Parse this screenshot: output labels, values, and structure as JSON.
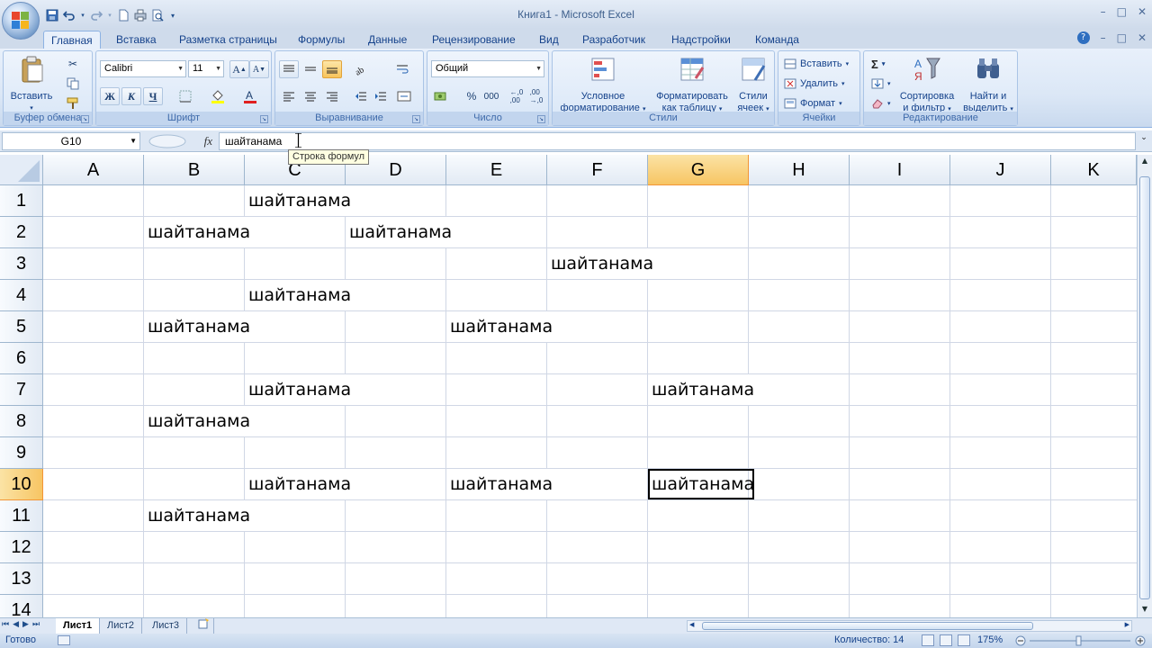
{
  "window": {
    "title": "Книга1 - Microsoft Excel",
    "controls": [
      "–",
      "□",
      "✕"
    ]
  },
  "qat": {
    "icons": [
      "save-icon",
      "undo-icon",
      "redo-icon",
      "new-icon",
      "print-icon",
      "print-preview-icon"
    ]
  },
  "tabs": [
    {
      "label": "Главная",
      "active": true
    },
    {
      "label": "Вставка"
    },
    {
      "label": "Разметка страницы"
    },
    {
      "label": "Формулы"
    },
    {
      "label": "Данные"
    },
    {
      "label": "Рецензирование"
    },
    {
      "label": "Вид"
    },
    {
      "label": "Разработчик"
    },
    {
      "label": "Надстройки"
    },
    {
      "label": "Команда"
    }
  ],
  "ribbon": {
    "clipboard": {
      "label": "Буфер обмена",
      "paste": "Вставить"
    },
    "font": {
      "label": "Шрифт",
      "name": "Calibri",
      "size": "11",
      "bold": "Ж",
      "italic": "К",
      "underline": "Ч"
    },
    "alignment": {
      "label": "Выравнивание"
    },
    "number": {
      "label": "Число",
      "format": "Общий",
      "percent": "%",
      "thousands": "000"
    },
    "styles": {
      "label": "Стили",
      "conditional": [
        "Условное",
        "форматирование"
      ],
      "as_table": [
        "Форматировать",
        "как таблицу"
      ],
      "cell_styles": [
        "Стили",
        "ячеек"
      ]
    },
    "cells": {
      "label": "Ячейки",
      "insert": "Вставить",
      "delete": "Удалить",
      "format": "Формат"
    },
    "editing": {
      "label": "Редактирование",
      "sum": "Σ",
      "sort": [
        "Сортировка",
        "и фильтр"
      ],
      "find": [
        "Найти и",
        "выделить"
      ]
    }
  },
  "formula_bar": {
    "name_box": "G10",
    "fx": "fx",
    "value": "шайтанама",
    "tooltip": "Строка формул"
  },
  "grid": {
    "columns": [
      "A",
      "B",
      "C",
      "D",
      "E",
      "F",
      "G",
      "H",
      "I",
      "J",
      "K"
    ],
    "rows": [
      "1",
      "2",
      "3",
      "4",
      "5",
      "6",
      "7",
      "8",
      "9",
      "10",
      "11",
      "12",
      "13",
      "14"
    ],
    "selected_column": "G",
    "selected_row": "10",
    "cells": [
      {
        "row": 1,
        "col": 3,
        "value": "шайтанама"
      },
      {
        "row": 2,
        "col": 2,
        "value": "шайтанама"
      },
      {
        "row": 2,
        "col": 4,
        "value": "шайтанама"
      },
      {
        "row": 3,
        "col": 6,
        "value": "шайтанама"
      },
      {
        "row": 4,
        "col": 3,
        "value": "шайтанама"
      },
      {
        "row": 5,
        "col": 2,
        "value": "шайтанама"
      },
      {
        "row": 5,
        "col": 5,
        "value": "шайтанама"
      },
      {
        "row": 7,
        "col": 3,
        "value": "шайтанама"
      },
      {
        "row": 7,
        "col": 7,
        "value": "шайтанама"
      },
      {
        "row": 8,
        "col": 2,
        "value": "шайтанама"
      },
      {
        "row": 10,
        "col": 3,
        "value": "шайтанама"
      },
      {
        "row": 10,
        "col": 5,
        "value": "шайтанама"
      },
      {
        "row": 10,
        "col": 7,
        "value": "шайтанама",
        "active": true
      },
      {
        "row": 11,
        "col": 2,
        "value": "шайтанама"
      }
    ]
  },
  "sheets": [
    {
      "label": "Лист1",
      "active": true
    },
    {
      "label": "Лист2"
    },
    {
      "label": "Лист3"
    }
  ],
  "status": {
    "ready": "Готово",
    "count": "Количество: 14",
    "zoom": "175%"
  },
  "colors": {
    "accent": "#15428b",
    "selected_header": "#f7c563",
    "gridline": "#d0d7e5"
  }
}
